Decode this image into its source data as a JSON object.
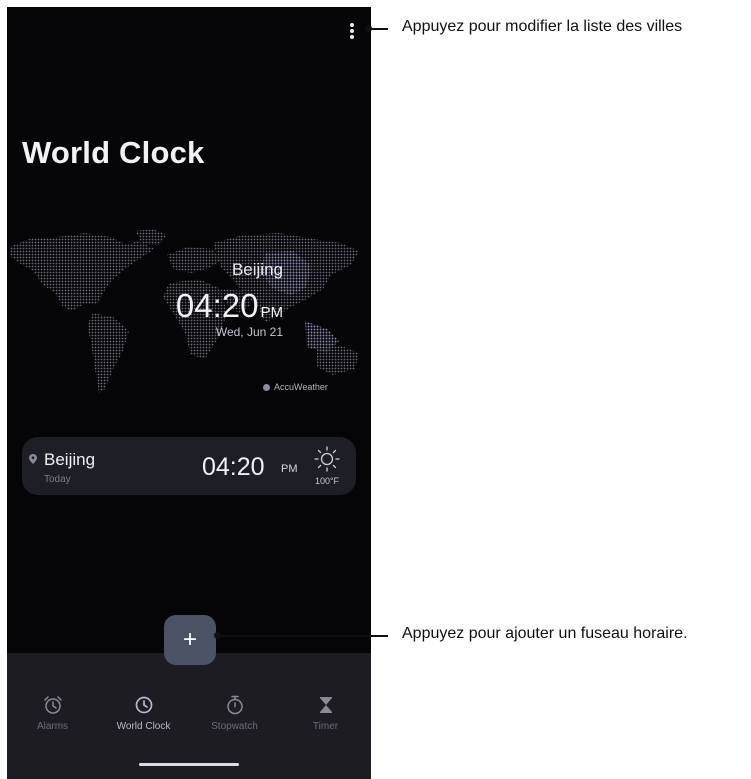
{
  "screen": {
    "title": "World Clock"
  },
  "hero": {
    "city": "Beijing",
    "time": "04:20",
    "ampm": "PM",
    "date": "Wed, Jun 21",
    "provider": "AccuWeather"
  },
  "cities": [
    {
      "name": "Beijing",
      "day": "Today",
      "time": "04:20",
      "ampm": "PM",
      "temp": "100°F",
      "weather_icon": "sun-icon"
    }
  ],
  "fab": {
    "label": "+"
  },
  "nav": {
    "items": [
      {
        "label": "Alarms",
        "icon": "alarm-icon",
        "active": false
      },
      {
        "label": "World Clock",
        "icon": "clock-icon",
        "active": true
      },
      {
        "label": "Stopwatch",
        "icon": "stopwatch-icon",
        "active": false
      },
      {
        "label": "Timer",
        "icon": "hourglass-icon",
        "active": false
      }
    ]
  },
  "annotations": {
    "menu": "Appuyez pour modifier la liste des villes",
    "add": "Appuyez pour ajouter un fuseau horaire."
  },
  "colors": {
    "background": "#050507",
    "card": "#1e1e26",
    "fab": "#4c5266",
    "navbar": "#1c1c22",
    "map_dots": "#6a6a78",
    "map_highlight": "#8a8ab0"
  }
}
